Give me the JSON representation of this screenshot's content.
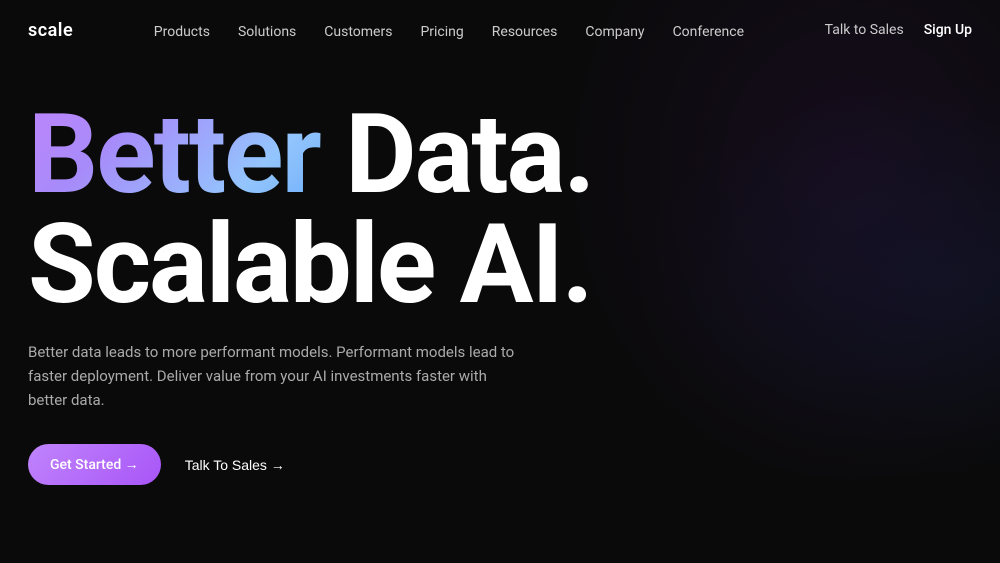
{
  "logo": {
    "text": "scale"
  },
  "nav": {
    "links": [
      {
        "label": "Products",
        "href": "#"
      },
      {
        "label": "Solutions",
        "href": "#"
      },
      {
        "label": "Customers",
        "href": "#"
      },
      {
        "label": "Pricing",
        "href": "#"
      },
      {
        "label": "Resources",
        "href": "#"
      },
      {
        "label": "Company",
        "href": "#"
      },
      {
        "label": "Conference",
        "href": "#"
      }
    ],
    "actions": {
      "talk_to_sales": "Talk to Sales",
      "sign_up": "Sign Up"
    }
  },
  "hero": {
    "headline_line1_part1": "Better ",
    "headline_line1_part2": "Data.",
    "headline_line2": "Scalable AI.",
    "subtitle": "Better data leads to more performant models. Performant models lead to faster deployment. Deliver value from your AI investments faster with better data.",
    "cta_primary": "Get Started →",
    "cta_secondary": "Talk To Sales →"
  }
}
